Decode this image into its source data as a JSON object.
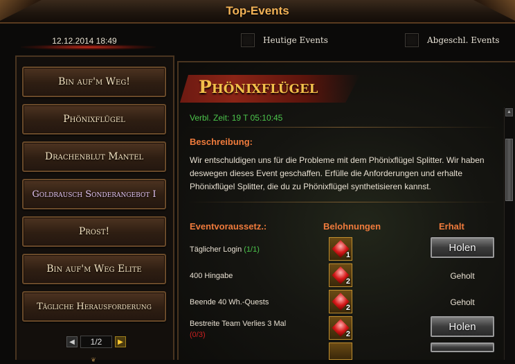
{
  "window": {
    "title": "Top-Events"
  },
  "header": {
    "datetime": "12.12.2014 18:49",
    "today_events_label": "Heutige Events",
    "completed_events_label": "Abgeschl. Events"
  },
  "sidebar": {
    "items": [
      {
        "label": "Bin auf'm Weg!"
      },
      {
        "label": "Phönixflügel"
      },
      {
        "label": "Drachenblut Mantel"
      },
      {
        "label": "Goldrausch Sonderangebot I"
      },
      {
        "label": "Prost!"
      },
      {
        "label": "Bin auf'm Weg Elite"
      },
      {
        "label": "Tägliche Herausforderung"
      }
    ],
    "pager": {
      "page": "1/2",
      "prev_icon": "arrow-left-icon",
      "next_icon": "arrow-right-icon"
    }
  },
  "event": {
    "title": "Phönixflügel",
    "remaining": "Verbl. Zeit: 19 T  05:10:45",
    "description_heading": "Beschreibung:",
    "description": "Wir entschuldigen uns für die Probleme mit dem Phönixflügel Splitter. Wir haben deswegen dieses Event geschaffen. Erfülle die Anforderungen und erhalte Phönixflügel Splitter, die du zu Phönixflügel synthetisieren kannst.",
    "columns": {
      "requirements": "Eventvoraussetz.:",
      "rewards": "Belohnungen",
      "receive": "Erhalt"
    },
    "rows": [
      {
        "requirement": "Täglicher Login",
        "progress": "(1/1)",
        "reward_count": "1",
        "status": "Holen",
        "claimable": true
      },
      {
        "requirement": "400 Hingabe",
        "progress": "",
        "reward_count": "2",
        "status": "Geholt",
        "claimable": false
      },
      {
        "requirement": "Beende 40 Wh.-Quests",
        "progress": "",
        "reward_count": "2",
        "status": "Geholt",
        "claimable": false
      },
      {
        "requirement": "Bestreite Team Verlies 3 Mal",
        "progress": "(0/3)",
        "reward_count": "2",
        "status": "Holen",
        "claimable": true
      }
    ]
  },
  "colors": {
    "accent": "#f07b3c",
    "title_gold": "#f2b256",
    "progress_green": "#4cc64c",
    "progress_red": "#cc2020"
  }
}
